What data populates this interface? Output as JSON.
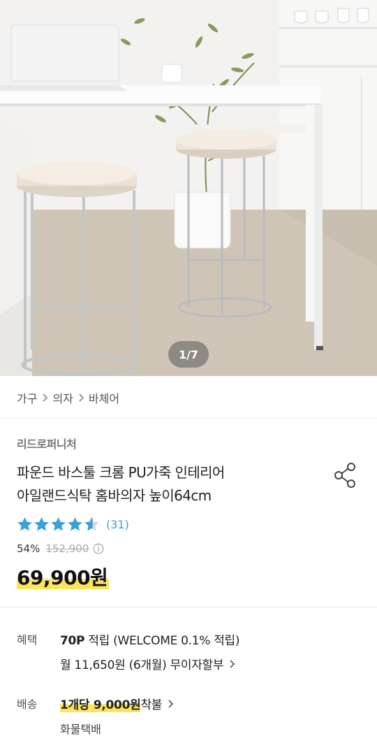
{
  "gallery": {
    "pager_text": "1/7",
    "image_alt": "product-photo-bar-stools"
  },
  "breadcrumb": {
    "items": [
      "가구",
      "의자",
      "바체어"
    ]
  },
  "product": {
    "brand": "리드로퍼니처",
    "title_line1": "파운드 바스툴 크롬 PU가죽 인테리어",
    "title_line2": "아일랜드식탁 홈바의자 높이64cm",
    "rating": 4.5,
    "review_count": "(31)",
    "discount": "54%",
    "original_price": "152,900",
    "price": "69,900원"
  },
  "benefit": {
    "label": "혜택",
    "points": "70P",
    "points_suffix": " 적립 (WELCOME 0.1% 적립)",
    "installment": "월 11,650원 (6개월) 무이자할부"
  },
  "shipping": {
    "label": "배송",
    "fee": "1개당 9,000원",
    "fee_suffix": " 착불",
    "method": "화물택배"
  },
  "colors": {
    "star": "#3aa0d8",
    "highlight": "#fbe55a",
    "review_link": "#3aa0d8"
  }
}
